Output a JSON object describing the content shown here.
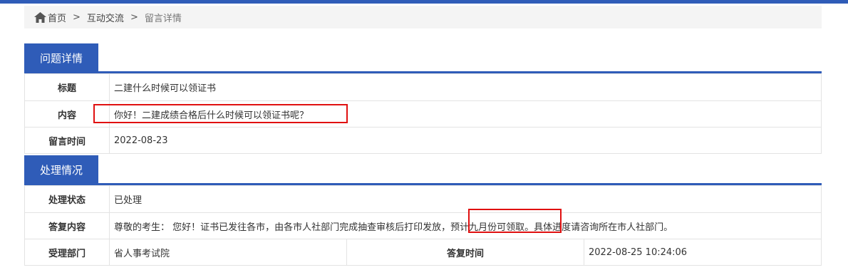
{
  "breadcrumb": {
    "home": "首页",
    "separator": ">",
    "level2": "互动交流",
    "current": "留言详情"
  },
  "question": {
    "section_title": "问题详情",
    "title_label": "标题",
    "title_value": "二建什么时候可以领证书",
    "content_label": "内容",
    "content_value": "你好！二建成绩合格后什么时候可以领证书呢？",
    "time_label": "留言时间",
    "time_value": "2022-08-23"
  },
  "handling": {
    "section_title": "处理情况",
    "status_label": "处理状态",
    "status_value": "已处理",
    "reply_label": "答复内容",
    "reply_value": "尊敬的考生： 您好！证书已发往各市，由各市人社部门完成抽查审核后打印发放，预计九月份可领取。具体进度请咨询所在市人社部门。",
    "dept_label": "受理部门",
    "dept_value": "省人事考试院",
    "reply_time_label": "答复时间",
    "reply_time_value": "2022-08-25 10:24:06"
  },
  "colors": {
    "accent": "#2f5cb8",
    "highlight": "#e01010"
  }
}
